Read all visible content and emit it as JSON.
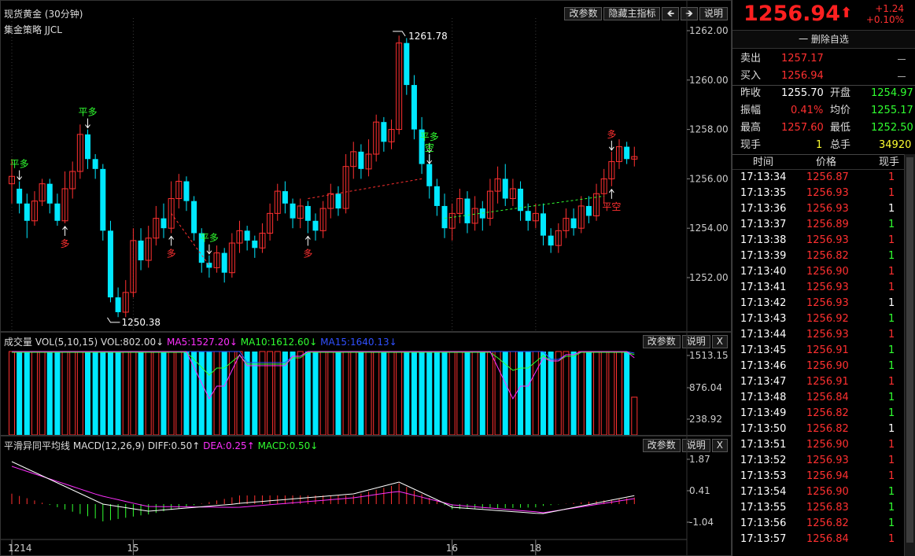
{
  "main": {
    "title": "现货黄金 (30分钟)",
    "strategy": "集金策略 JJCL",
    "buttons": {
      "params": "改参数",
      "hide": "隐藏主指标",
      "left": "🡸",
      "right": "🡺",
      "help": "说明"
    }
  },
  "volume": {
    "label": "成交量",
    "vol_label": "VOL(5,10,15)",
    "vol_value": "VOL:802.00↓",
    "ma5": "MA5:1527.20↓",
    "ma10": "MA10:1612.60↓",
    "ma15": "MA15:1640.13↓",
    "buttons": {
      "params": "改参数",
      "help": "说明",
      "close": "X"
    }
  },
  "macd": {
    "label": "平滑异同平均线",
    "macd_label": "MACD(12,26,9)",
    "diff": "DIFF:0.50↑",
    "dea": "DEA:0.25↑",
    "macd_value": "MACD:0.50↓",
    "buttons": {
      "params": "改参数",
      "help": "说明",
      "close": "X"
    }
  },
  "colors": {
    "up": "#ff3030",
    "down": "#00e8ff",
    "ma5": "#ff30ff",
    "ma10": "#30ff30",
    "ma15": "#3050ff"
  },
  "chart_data": {
    "type": "candlestick",
    "interval": "30分钟",
    "price_ticks": [
      "1262.00",
      "1260.00",
      "1258.00",
      "1256.00",
      "1254.00",
      "1252.00"
    ],
    "vol_ticks": [
      "1513.15",
      "876.04",
      "238.92"
    ],
    "macd_ticks": [
      "1.87",
      "0.41",
      "-1.04"
    ],
    "x_labels": [
      {
        "label": "1214",
        "index": 0
      },
      {
        "label": "15",
        "index": 16
      },
      {
        "label": "16",
        "index": 58
      },
      {
        "label": "18",
        "index": 69
      }
    ],
    "high_marker": {
      "text": "1261.78",
      "index": 51
    },
    "low_marker": {
      "text": "1250.38",
      "index": 13
    },
    "signals": [
      {
        "text": "平多",
        "index": 1,
        "type": "close-long"
      },
      {
        "text": "多",
        "index": 7,
        "type": "long"
      },
      {
        "text": "平多",
        "index": 10,
        "type": "close-long"
      },
      {
        "text": "多",
        "index": 21,
        "type": "long"
      },
      {
        "text": "平多",
        "index": 26,
        "type": "close-long"
      },
      {
        "text": "多",
        "index": 39,
        "type": "long"
      },
      {
        "text": "平多",
        "index": 55,
        "type": "close-long"
      },
      {
        "text": "空",
        "index": 55,
        "type": "short"
      },
      {
        "text": "平空",
        "index": 79,
        "type": "close-short"
      },
      {
        "text": "多",
        "index": 79,
        "type": "long"
      }
    ],
    "candles": [
      [
        1255.8,
        1256.1,
        1255.0,
        1256.8
      ],
      [
        1255.6,
        1255.0,
        1254.6,
        1255.9
      ],
      [
        1255.0,
        1254.3,
        1253.6,
        1255.4
      ],
      [
        1254.3,
        1255.1,
        1254.1,
        1255.5
      ],
      [
        1255.1,
        1255.8,
        1254.9,
        1256.0
      ],
      [
        1255.8,
        1255.0,
        1254.6,
        1256.0
      ],
      [
        1255.0,
        1254.3,
        1254.1,
        1255.4
      ],
      [
        1254.3,
        1255.6,
        1254.2,
        1256.3
      ],
      [
        1255.6,
        1256.3,
        1255.2,
        1256.7
      ],
      [
        1256.3,
        1257.8,
        1256.0,
        1258.2
      ],
      [
        1257.8,
        1256.8,
        1256.4,
        1258.0
      ],
      [
        1256.8,
        1256.4,
        1256.0,
        1257.0
      ],
      [
        1256.4,
        1253.9,
        1253.5,
        1256.6
      ],
      [
        1253.9,
        1251.2,
        1251.0,
        1254.3
      ],
      [
        1251.2,
        1250.6,
        1250.4,
        1251.6
      ],
      [
        1250.6,
        1251.4,
        1250.4,
        1251.9
      ],
      [
        1251.4,
        1253.5,
        1251.2,
        1254.0
      ],
      [
        1253.5,
        1252.7,
        1252.3,
        1254.0
      ],
      [
        1252.7,
        1253.6,
        1252.4,
        1254.1
      ],
      [
        1253.6,
        1254.4,
        1253.3,
        1254.9
      ],
      [
        1254.4,
        1254.0,
        1253.6,
        1255.0
      ],
      [
        1254.0,
        1255.2,
        1253.8,
        1255.9
      ],
      [
        1255.2,
        1255.9,
        1254.8,
        1256.2
      ],
      [
        1255.9,
        1255.1,
        1254.7,
        1256.1
      ],
      [
        1255.1,
        1253.8,
        1253.5,
        1255.3
      ],
      [
        1253.8,
        1252.6,
        1252.2,
        1254.0
      ],
      [
        1252.6,
        1252.4,
        1252.0,
        1252.9
      ],
      [
        1252.4,
        1253.0,
        1252.2,
        1253.3
      ],
      [
        1253.0,
        1252.2,
        1251.8,
        1253.2
      ],
      [
        1252.2,
        1253.4,
        1252.0,
        1253.8
      ],
      [
        1253.4,
        1253.9,
        1253.0,
        1254.3
      ],
      [
        1253.9,
        1253.5,
        1253.1,
        1254.1
      ],
      [
        1253.5,
        1253.2,
        1252.8,
        1253.7
      ],
      [
        1253.2,
        1253.8,
        1253.0,
        1254.2
      ],
      [
        1253.8,
        1254.6,
        1253.5,
        1255.0
      ],
      [
        1254.6,
        1255.5,
        1254.3,
        1255.8
      ],
      [
        1255.5,
        1255.0,
        1254.6,
        1255.9
      ],
      [
        1255.0,
        1254.4,
        1254.0,
        1255.2
      ],
      [
        1254.4,
        1254.9,
        1254.0,
        1255.2
      ],
      [
        1254.9,
        1254.3,
        1253.8,
        1255.1
      ],
      [
        1254.3,
        1253.9,
        1253.5,
        1254.6
      ],
      [
        1253.9,
        1254.8,
        1253.6,
        1255.1
      ],
      [
        1254.8,
        1255.4,
        1254.4,
        1255.8
      ],
      [
        1255.4,
        1254.8,
        1254.5,
        1255.7
      ],
      [
        1254.8,
        1256.5,
        1254.6,
        1257.0
      ],
      [
        1256.5,
        1257.1,
        1256.0,
        1257.5
      ],
      [
        1257.1,
        1256.4,
        1256.0,
        1257.4
      ],
      [
        1256.4,
        1257.0,
        1256.1,
        1257.6
      ],
      [
        1257.0,
        1258.3,
        1256.7,
        1258.6
      ],
      [
        1258.3,
        1257.5,
        1257.1,
        1258.5
      ],
      [
        1257.5,
        1258.0,
        1257.2,
        1258.4
      ],
      [
        1258.0,
        1261.5,
        1257.8,
        1261.8
      ],
      [
        1261.5,
        1259.8,
        1259.4,
        1261.7
      ],
      [
        1259.8,
        1258.0,
        1257.6,
        1260.2
      ],
      [
        1258.0,
        1256.6,
        1256.2,
        1258.5
      ],
      [
        1256.6,
        1255.7,
        1255.2,
        1257.0
      ],
      [
        1255.7,
        1254.9,
        1254.5,
        1256.0
      ],
      [
        1254.9,
        1254.0,
        1253.6,
        1255.4
      ],
      [
        1254.0,
        1254.6,
        1253.5,
        1255.0
      ],
      [
        1254.6,
        1255.2,
        1254.2,
        1255.6
      ],
      [
        1255.2,
        1254.2,
        1253.8,
        1255.5
      ],
      [
        1254.2,
        1254.8,
        1253.9,
        1255.3
      ],
      [
        1254.8,
        1254.4,
        1253.9,
        1255.1
      ],
      [
        1254.4,
        1255.5,
        1254.1,
        1256.0
      ],
      [
        1255.5,
        1256.0,
        1255.0,
        1256.5
      ],
      [
        1256.0,
        1255.2,
        1254.9,
        1256.6
      ],
      [
        1255.2,
        1255.6,
        1254.9,
        1256.0
      ],
      [
        1255.6,
        1254.7,
        1254.3,
        1255.9
      ],
      [
        1254.7,
        1254.3,
        1253.9,
        1255.0
      ],
      [
        1254.3,
        1254.6,
        1254.0,
        1255.0
      ],
      [
        1254.6,
        1253.7,
        1253.3,
        1255.0
      ],
      [
        1253.7,
        1253.3,
        1253.0,
        1254.0
      ],
      [
        1253.3,
        1253.9,
        1253.0,
        1254.2
      ],
      [
        1253.9,
        1254.4,
        1253.6,
        1254.8
      ],
      [
        1254.4,
        1254.0,
        1253.7,
        1254.8
      ],
      [
        1254.0,
        1254.9,
        1253.8,
        1255.3
      ],
      [
        1254.9,
        1254.5,
        1254.2,
        1255.3
      ],
      [
        1254.5,
        1255.4,
        1254.3,
        1255.8
      ],
      [
        1255.4,
        1256.0,
        1255.0,
        1256.4
      ],
      [
        1256.0,
        1256.7,
        1255.7,
        1257.1
      ],
      [
        1256.7,
        1257.3,
        1256.4,
        1257.6
      ],
      [
        1257.3,
        1256.8,
        1256.6,
        1257.5
      ],
      [
        1256.8,
        1256.9,
        1256.5,
        1257.3
      ]
    ],
    "volume": [
      1500,
      1500,
      1500,
      1500,
      1500,
      1500,
      1500,
      1500,
      1500,
      1500,
      1500,
      1500,
      1500,
      1500,
      1500,
      1500,
      1500,
      1500,
      1500,
      1500,
      1500,
      1500,
      1500,
      1500,
      1500,
      1500,
      1500,
      1500,
      1500,
      1500,
      1500,
      1500,
      1500,
      1500,
      1500,
      1500,
      1500,
      1500,
      1500,
      1500,
      1500,
      1500,
      1500,
      1500,
      1500,
      1500,
      1500,
      1500,
      1500,
      1500,
      1500,
      1500,
      1500,
      1500,
      1500,
      1500,
      1500,
      1500,
      1500,
      1500,
      1500,
      1500,
      1500,
      1500,
      1500,
      1500,
      1500,
      1500,
      1500,
      1500,
      1500,
      1500,
      1500,
      1500,
      1500,
      1500,
      1500,
      1500,
      1500,
      1500,
      1500,
      1500,
      802
    ]
  },
  "quote": {
    "price": "1256.94",
    "arrow": "⬆",
    "change": "+1.24",
    "change_pct": "+0.10%",
    "remove": "一 删除自选",
    "sell_label": "卖出",
    "sell": "1257.17",
    "buy_label": "买入",
    "buy": "1256.94",
    "prev_label": "昨收",
    "prev": "1255.70",
    "open_label": "开盘",
    "open": "1254.97",
    "amp_label": "振幅",
    "amp": "0.41%",
    "avg_label": "均价",
    "avg": "1255.17",
    "high_label": "最高",
    "high": "1257.60",
    "low_label": "最低",
    "low": "1252.50",
    "cur_label": "现手",
    "cur": "1",
    "total_label": "总手",
    "total": "34920"
  },
  "ticks": {
    "headers": [
      "时间",
      "价格",
      "现手"
    ],
    "rows": [
      {
        "time": "17:13:34",
        "price": "1256.87",
        "qty": "1",
        "c": "red"
      },
      {
        "time": "17:13:35",
        "price": "1256.93",
        "qty": "1",
        "c": "red"
      },
      {
        "time": "17:13:36",
        "price": "1256.93",
        "qty": "1",
        "c": "wht"
      },
      {
        "time": "17:13:37",
        "price": "1256.89",
        "qty": "1",
        "c": "grn"
      },
      {
        "time": "17:13:38",
        "price": "1256.93",
        "qty": "1",
        "c": "red"
      },
      {
        "time": "17:13:39",
        "price": "1256.82",
        "qty": "1",
        "c": "grn"
      },
      {
        "time": "17:13:40",
        "price": "1256.90",
        "qty": "1",
        "c": "red"
      },
      {
        "time": "17:13:41",
        "price": "1256.93",
        "qty": "1",
        "c": "red"
      },
      {
        "time": "17:13:42",
        "price": "1256.93",
        "qty": "1",
        "c": "wht"
      },
      {
        "time": "17:13:43",
        "price": "1256.92",
        "qty": "1",
        "c": "grn"
      },
      {
        "time": "17:13:44",
        "price": "1256.93",
        "qty": "1",
        "c": "red"
      },
      {
        "time": "17:13:45",
        "price": "1256.91",
        "qty": "1",
        "c": "grn"
      },
      {
        "time": "17:13:46",
        "price": "1256.90",
        "qty": "1",
        "c": "grn"
      },
      {
        "time": "17:13:47",
        "price": "1256.91",
        "qty": "1",
        "c": "red"
      },
      {
        "time": "17:13:48",
        "price": "1256.84",
        "qty": "1",
        "c": "grn"
      },
      {
        "time": "17:13:49",
        "price": "1256.82",
        "qty": "1",
        "c": "grn"
      },
      {
        "time": "17:13:50",
        "price": "1256.82",
        "qty": "1",
        "c": "wht"
      },
      {
        "time": "17:13:51",
        "price": "1256.90",
        "qty": "1",
        "c": "red"
      },
      {
        "time": "17:13:52",
        "price": "1256.93",
        "qty": "1",
        "c": "red"
      },
      {
        "time": "17:13:53",
        "price": "1256.94",
        "qty": "1",
        "c": "red"
      },
      {
        "time": "17:13:54",
        "price": "1256.90",
        "qty": "1",
        "c": "grn"
      },
      {
        "time": "17:13:55",
        "price": "1256.83",
        "qty": "1",
        "c": "grn"
      },
      {
        "time": "17:13:56",
        "price": "1256.82",
        "qty": "1",
        "c": "grn"
      },
      {
        "time": "17:13:57",
        "price": "1256.84",
        "qty": "1",
        "c": "red"
      }
    ]
  }
}
